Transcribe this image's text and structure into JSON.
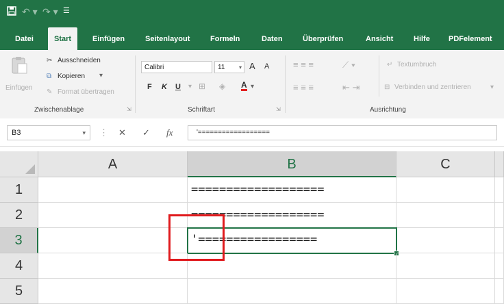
{
  "app": {
    "accent": "#217346",
    "qat_icons": [
      "save-icon",
      "undo-icon",
      "redo-icon",
      "customize-icon"
    ]
  },
  "tabs": [
    "Datei",
    "Start",
    "Einfügen",
    "Seitenlayout",
    "Formeln",
    "Daten",
    "Überprüfen",
    "Ansicht",
    "Hilfe",
    "PDFelement"
  ],
  "active_tab": "Start",
  "clipboard": {
    "paste": "Einfügen",
    "cut": "Ausschneiden",
    "copy": "Kopieren",
    "copy_arrow": "▾",
    "format_painter": "Format übertragen",
    "group": "Zwischenablage"
  },
  "font": {
    "name": "Calibri",
    "size": "11",
    "grow": "A",
    "shrink": "A",
    "bold": "F",
    "italic": "K",
    "underline": "U",
    "group": "Schriftart"
  },
  "alignment": {
    "wrap": "Textumbruch",
    "merge": "Verbinden und zentrieren",
    "group": "Ausrichtung"
  },
  "formula_bar": {
    "name_box": "B3",
    "cancel": "✕",
    "enter": "✓",
    "fx": "fx",
    "content": "'=================="
  },
  "sheet": {
    "columns": [
      "A",
      "B",
      "C"
    ],
    "rows": [
      "1",
      "2",
      "3",
      "4",
      "5"
    ],
    "selected_cell": "B3",
    "cells": {
      "B1": "===================",
      "B2": "===================",
      "B3": "'================="
    }
  }
}
